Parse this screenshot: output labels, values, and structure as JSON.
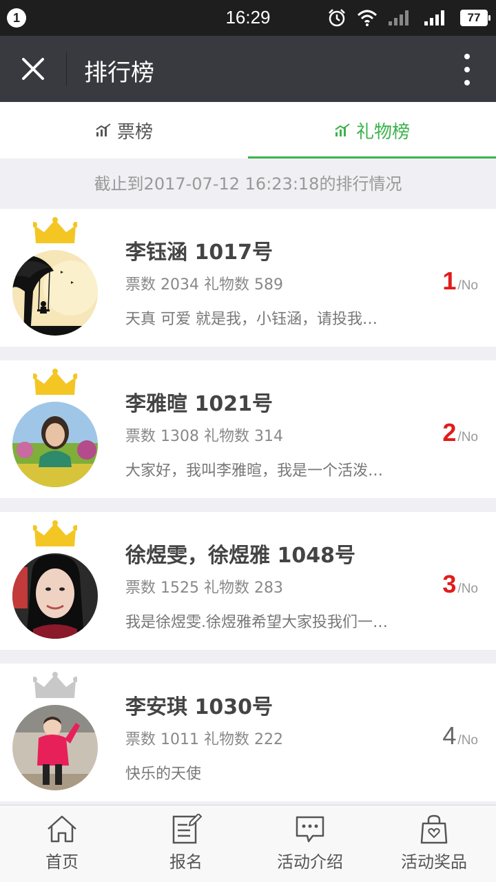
{
  "status_bar": {
    "notification_count": "1",
    "time": "16:29",
    "battery": "77",
    "icons": [
      "alarm-icon",
      "wifi-icon",
      "signal-icon",
      "signal-icon"
    ]
  },
  "title_bar": {
    "close_icon": "close-icon",
    "title": "排行榜",
    "more_icon": "more-vertical-icon"
  },
  "tabs": [
    {
      "label": "票榜",
      "icon": "bar-chart-icon",
      "active": false
    },
    {
      "label": "礼物榜",
      "icon": "bar-chart-icon",
      "active": true
    }
  ],
  "notice": "截止到2017-07-12 16:23:18的排行情况",
  "accent_color": "#3bb34a",
  "rank_color": "#e21b1b",
  "ranking": [
    {
      "name": "李钰涵  1017号",
      "stats": "票数 2034 礼物数 589",
      "desc": "天真 可爱 就是我，小钰涵，请投我…",
      "rank": "1",
      "suffix": "/No",
      "crown": "gold"
    },
    {
      "name": "李雅暄  1021号",
      "stats": "票数 1308 礼物数 314",
      "desc": "大家好，我叫李雅暄，我是一个活泼…",
      "rank": "2",
      "suffix": "/No",
      "crown": "gold"
    },
    {
      "name": "徐煜雯，徐煜雅  1048号",
      "stats": "票数 1525 礼物数 283",
      "desc": "我是徐煜雯.徐煜雅希望大家投我们一…",
      "rank": "3",
      "suffix": "/No",
      "crown": "gold"
    },
    {
      "name": "李安琪  1030号",
      "stats": "票数 1011 礼物数 222",
      "desc": "快乐的天使",
      "rank": "4",
      "suffix": "/No",
      "crown": "silver"
    }
  ],
  "bottom_nav": [
    {
      "label": "首页",
      "icon": "home-icon"
    },
    {
      "label": "报名",
      "icon": "edit-icon"
    },
    {
      "label": "活动介绍",
      "icon": "chat-icon"
    },
    {
      "label": "活动奖品",
      "icon": "gift-bag-icon"
    }
  ]
}
